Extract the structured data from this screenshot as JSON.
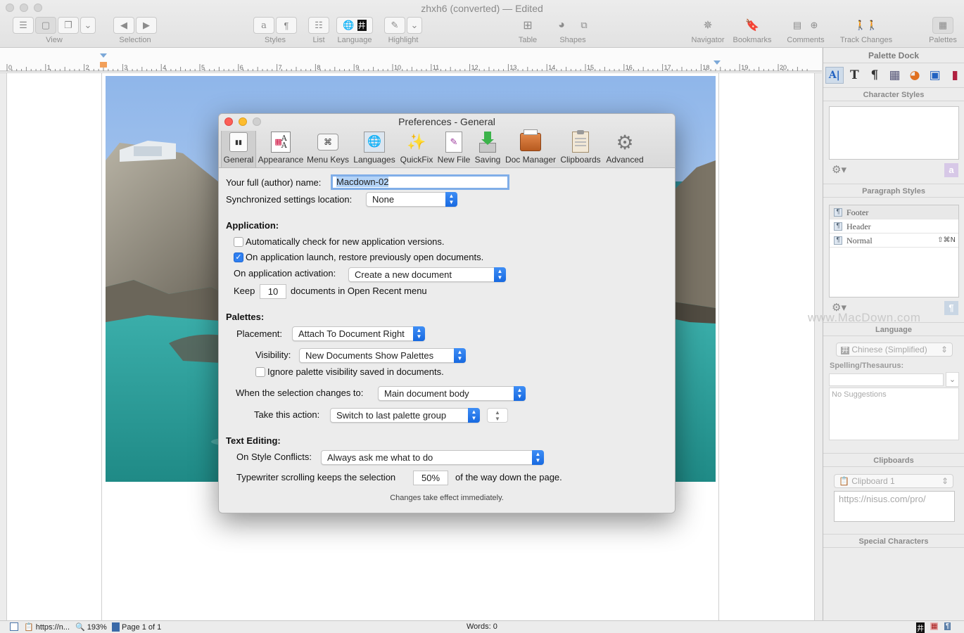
{
  "window": {
    "title": "zhxh6 (converted) — Edited"
  },
  "toolbar": {
    "view_label": "View",
    "selection_label": "Selection",
    "styles_label": "Styles",
    "list_label": "List",
    "language_label": "Language",
    "highlight_label": "Highlight",
    "table_label": "Table",
    "shapes_label": "Shapes",
    "navigator_label": "Navigator",
    "bookmarks_label": "Bookmarks",
    "comments_label": "Comments",
    "track_changes_label": "Track Changes",
    "palettes_label": "Palettes"
  },
  "ruler": {
    "numbers": [
      "0",
      "1",
      "2",
      "3",
      "4",
      "5",
      "6",
      "7",
      "8",
      "9",
      "10",
      "11",
      "12",
      "13",
      "14",
      "15",
      "16",
      "17",
      "18",
      "19",
      "20"
    ]
  },
  "prefs": {
    "title": "Preferences - General",
    "tabs": [
      {
        "label": "General",
        "icon": "general-icon"
      },
      {
        "label": "Appearance",
        "icon": "appearance-icon"
      },
      {
        "label": "Menu Keys",
        "icon": "menu-keys-icon"
      },
      {
        "label": "Languages",
        "icon": "languages-icon"
      },
      {
        "label": "QuickFix",
        "icon": "quickfix-icon"
      },
      {
        "label": "New File",
        "icon": "new-file-icon"
      },
      {
        "label": "Saving",
        "icon": "saving-icon"
      },
      {
        "label": "Doc Manager",
        "icon": "doc-manager-icon"
      },
      {
        "label": "Clipboards",
        "icon": "clipboards-icon"
      },
      {
        "label": "Advanced",
        "icon": "advanced-icon"
      }
    ],
    "author_label": "Your full (author) name:",
    "author_value": "Macdown-02",
    "sync_label": "Synchronized settings location:",
    "sync_value": "None",
    "application_header": "Application:",
    "auto_check_label": "Automatically check for new application versions.",
    "auto_check_checked": false,
    "restore_label": "On application launch, restore previously open documents.",
    "restore_checked": true,
    "activation_label": "On application activation:",
    "activation_value": "Create a new document",
    "keep_label": "Keep",
    "keep_value": "10",
    "keep_suffix": "documents in Open Recent menu",
    "palettes_header": "Palettes:",
    "placement_label": "Placement:",
    "placement_value": "Attach To Document Right",
    "visibility_label": "Visibility:",
    "visibility_value": "New Documents Show Palettes",
    "ignore_label": "Ignore palette visibility saved in documents.",
    "ignore_checked": false,
    "selection_changes_label": "When the selection changes to:",
    "selection_changes_value": "Main document body",
    "action_label": "Take this action:",
    "action_value": "Switch to last palette group",
    "text_editing_header": "Text Editing:",
    "style_conflicts_label": "On Style Conflicts:",
    "style_conflicts_value": "Always ask me what to do",
    "typewriter_label": "Typewriter scrolling keeps the selection",
    "typewriter_value": "50%",
    "typewriter_suffix": "of the way down the page.",
    "note": "Changes take effect immediately."
  },
  "dock": {
    "title": "Palette Dock",
    "character_styles": "Character Styles",
    "paragraph_styles": "Paragraph Styles",
    "styles": [
      {
        "name": "Footer",
        "shortcut": ""
      },
      {
        "name": "Header",
        "shortcut": ""
      },
      {
        "name": "Normal",
        "shortcut": "⇧⌘N"
      }
    ],
    "language": "Language",
    "language_value": "Chinese (Simplified)",
    "spelling_label": "Spelling/Thesaurus:",
    "no_suggestions": "No Suggestions",
    "clipboards": "Clipboards",
    "clipboard_value": "Clipboard 1",
    "clipboard_content": "https://nisus.com/pro/",
    "special_characters": "Special Characters",
    "watermark": "www.MacDown.com"
  },
  "status": {
    "url": "https://n...",
    "zoom": "193%",
    "page": "Page 1 of 1",
    "words": "Words: 0"
  },
  "colors": {
    "accent": "#2f7ff0",
    "close": "#fc5f57",
    "minimize": "#fdbc2e"
  }
}
